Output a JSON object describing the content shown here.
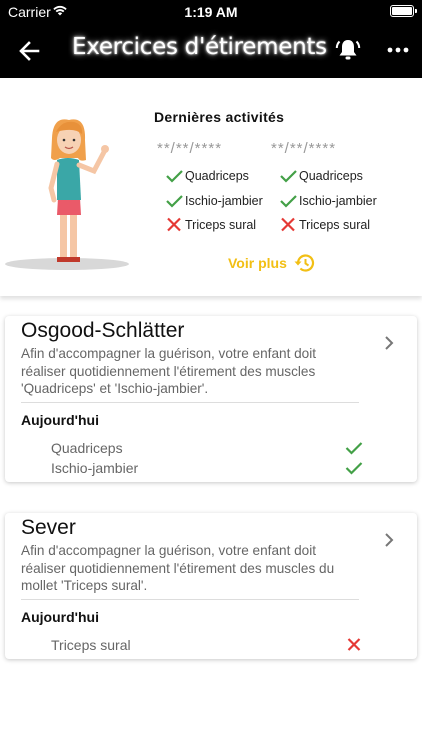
{
  "status_bar": {
    "carrier": "Carrier",
    "time": "1:19 AM"
  },
  "app_bar": {
    "title": "Exercices d'étirements"
  },
  "activities": {
    "title": "Dernières activités",
    "columns": [
      {
        "date": "**/**/****",
        "items": [
          {
            "label": "Quadriceps",
            "status": "done"
          },
          {
            "label": "Ischio-jambier",
            "status": "done"
          },
          {
            "label": "Triceps sural",
            "status": "missed"
          }
        ]
      },
      {
        "date": "**/**/****",
        "items": [
          {
            "label": "Quadriceps",
            "status": "done"
          },
          {
            "label": "Ischio-jambier",
            "status": "done"
          },
          {
            "label": "Triceps sural",
            "status": "missed"
          }
        ]
      }
    ],
    "see_more": "Voir plus"
  },
  "cards": [
    {
      "title": "Osgood-Schlätter",
      "description": "Afin d'accompagner la guérison, votre enfant doit réaliser quotidiennement l'étirement des muscles 'Quadriceps' et 'Ischio-jambier'.",
      "today_label": "Aujourd'hui",
      "exercises": [
        {
          "label": "Quadriceps",
          "status": "done"
        },
        {
          "label": "Ischio-jambier",
          "status": "done"
        }
      ]
    },
    {
      "title": "Sever",
      "description": "Afin d'accompagner la guérison, votre enfant doit réaliser quotidiennement l'étirement des muscles du mollet 'Triceps sural'.",
      "today_label": "Aujourd'hui",
      "exercises": [
        {
          "label": "Triceps sural",
          "status": "missed"
        }
      ]
    }
  ],
  "colors": {
    "check": "#43a047",
    "cross": "#e53935",
    "accent": "#f2bf14",
    "bar": "#000000"
  },
  "icons": {
    "back": "arrow-left-icon",
    "bell": "alarm-bell-icon",
    "more": "more-dots-icon",
    "history": "history-icon",
    "chevron": "chevron-right-icon"
  }
}
